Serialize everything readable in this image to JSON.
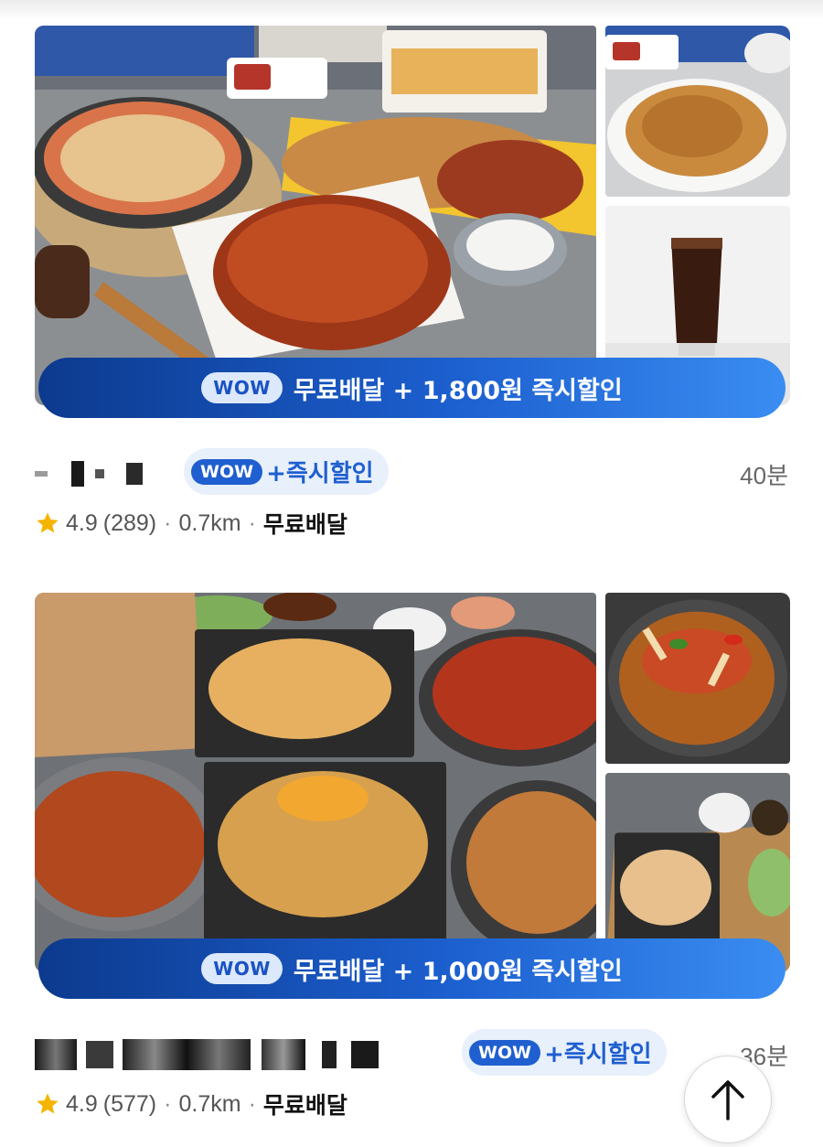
{
  "stores": [
    {
      "promo": {
        "wow_label": "WOW",
        "text": "무료배달 + 1,800원 즉시할인"
      },
      "badge": {
        "wow_label": "WOW",
        "text": "+즉시할인"
      },
      "delivery_time": "40분",
      "rating": "4.9",
      "review_count": "(289)",
      "distance": "0.7km",
      "delivery_fee_label": "무료배달",
      "photos": [
        "fried-chicken-spread",
        "fried-chicken-plate",
        "cola-glass"
      ]
    },
    {
      "promo": {
        "wow_label": "WOW",
        "text": "무료배달 + 1,000원 즉시할인"
      },
      "badge": {
        "wow_label": "WOW",
        "text": "+즉시할인"
      },
      "delivery_time": "36분",
      "rating": "4.9",
      "review_count": "(577)",
      "distance": "0.7km",
      "delivery_fee_label": "무료배달",
      "photos": [
        "chicken-variety-spread",
        "spicy-chicken-pan",
        "chicken-side-dishes"
      ]
    }
  ],
  "meta_separator": "·",
  "icons": {
    "rating": "star-icon",
    "scroll_top": "arrow-up-icon"
  },
  "colors": {
    "accent": "#1f5fd0",
    "star": "#f5b400",
    "banner_dark": "#0c3a8e",
    "banner_light": "#3a8df2"
  }
}
